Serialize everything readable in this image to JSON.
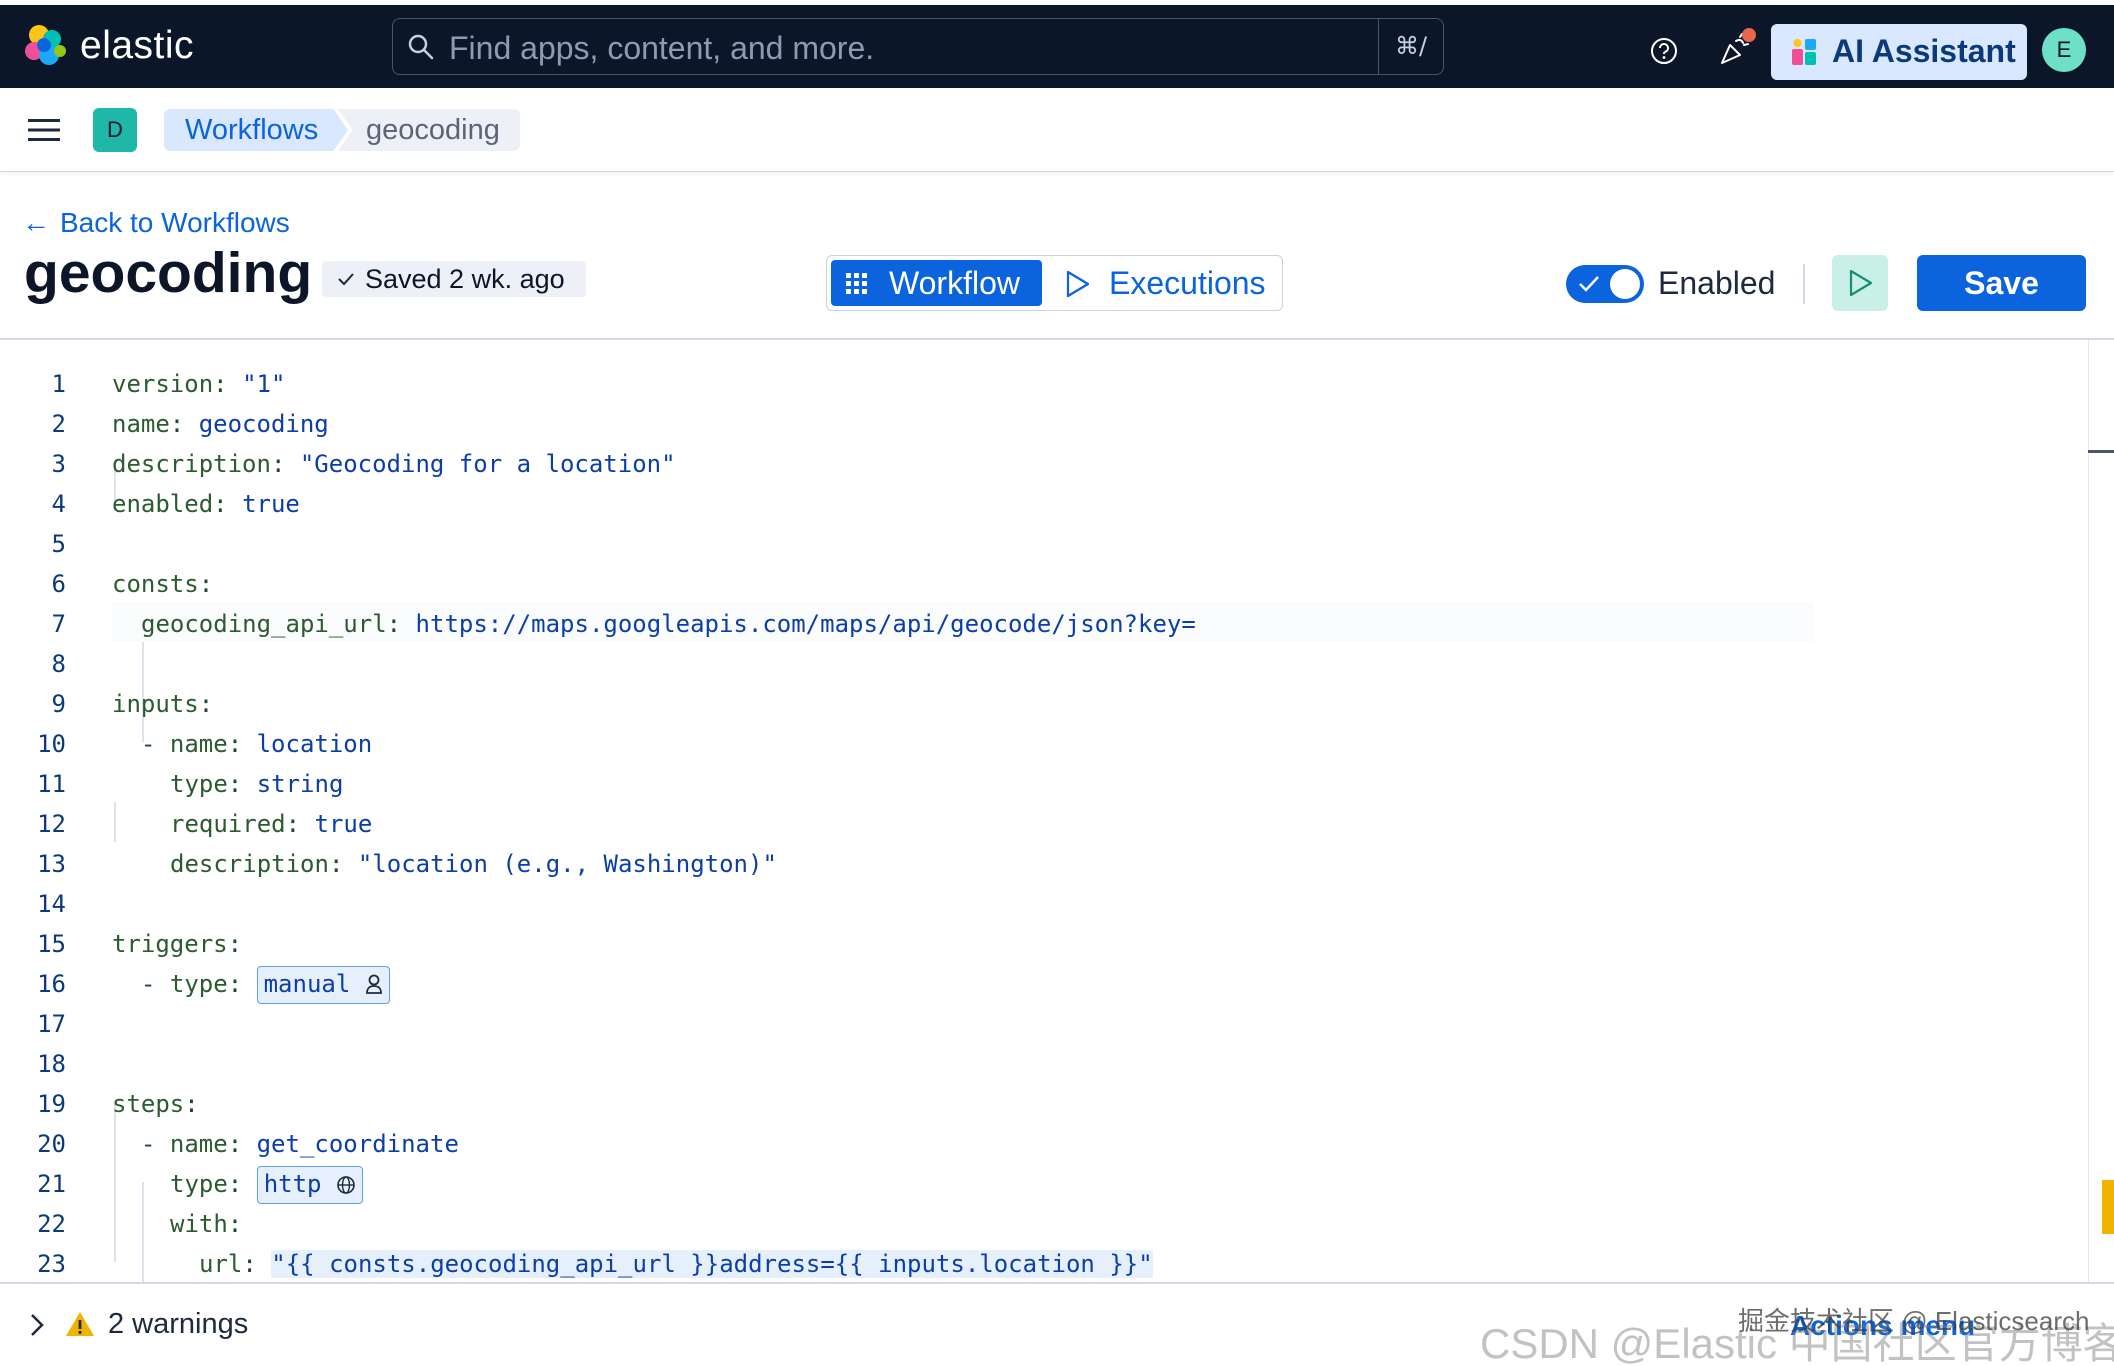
{
  "header": {
    "brand": "elastic",
    "search_placeholder": "Find apps, content, and more.",
    "search_shortcut": "⌘/",
    "ai_assistant_label": "AI Assistant",
    "avatar_initial": "E"
  },
  "breadcrumbs": {
    "space_initial": "D",
    "items": [
      "Workflows",
      "geocoding"
    ]
  },
  "page": {
    "back_link": "Back to Workflows",
    "title": "geocoding",
    "saved_status": "Saved 2 wk. ago",
    "tabs": [
      {
        "label": "Workflow",
        "active": true
      },
      {
        "label": "Executions",
        "active": false
      }
    ],
    "enabled_label": "Enabled",
    "enabled": true,
    "save_label": "Save"
  },
  "editor": {
    "lines": [
      {
        "n": "1",
        "key": "version",
        "value": "\"1\""
      },
      {
        "n": "2",
        "key": "name",
        "value": "geocoding"
      },
      {
        "n": "3",
        "key": "description",
        "value": "\"Geocoding for a location\""
      },
      {
        "n": "4",
        "key": "enabled",
        "value": "true"
      },
      {
        "n": "5"
      },
      {
        "n": "6",
        "key": "consts",
        "value": ""
      },
      {
        "n": "7",
        "key": "geocoding_api_url",
        "value": "https://maps.googleapis.com/maps/api/geocode/json?key="
      },
      {
        "n": "8"
      },
      {
        "n": "9",
        "key": "inputs",
        "value": ""
      },
      {
        "n": "10",
        "key": "name",
        "value": "location"
      },
      {
        "n": "11",
        "key": "type",
        "value": "string"
      },
      {
        "n": "12",
        "key": "required",
        "value": "true"
      },
      {
        "n": "13",
        "key": "description",
        "value": "\"location (e.g., Washington)\""
      },
      {
        "n": "14"
      },
      {
        "n": "15",
        "key": "triggers",
        "value": ""
      },
      {
        "n": "16",
        "key": "type",
        "value": "manual"
      },
      {
        "n": "17"
      },
      {
        "n": "18"
      },
      {
        "n": "19",
        "key": "steps",
        "value": ""
      },
      {
        "n": "20",
        "key": "name",
        "value": "get_coordinate"
      },
      {
        "n": "21",
        "key": "type",
        "value": "http"
      },
      {
        "n": "22",
        "key": "with",
        "value": ""
      },
      {
        "n": "23",
        "key": "url",
        "value": "\"{{ consts.geocoding_api_url }}address={{ inputs.location }}\""
      }
    ]
  },
  "footer": {
    "warnings_label": "2 warnings",
    "actions_menu": "Actions menu",
    "watermark_top": "掘金技术社区 @ Elasticsearch",
    "watermark_bottom": "CSDN @Elastic 中国社区官方博客"
  },
  "colors": {
    "header_bg": "#0b1628",
    "primary": "#0b64dd",
    "run_button_bg": "#c8f0e6",
    "warning": "#f0b400"
  }
}
